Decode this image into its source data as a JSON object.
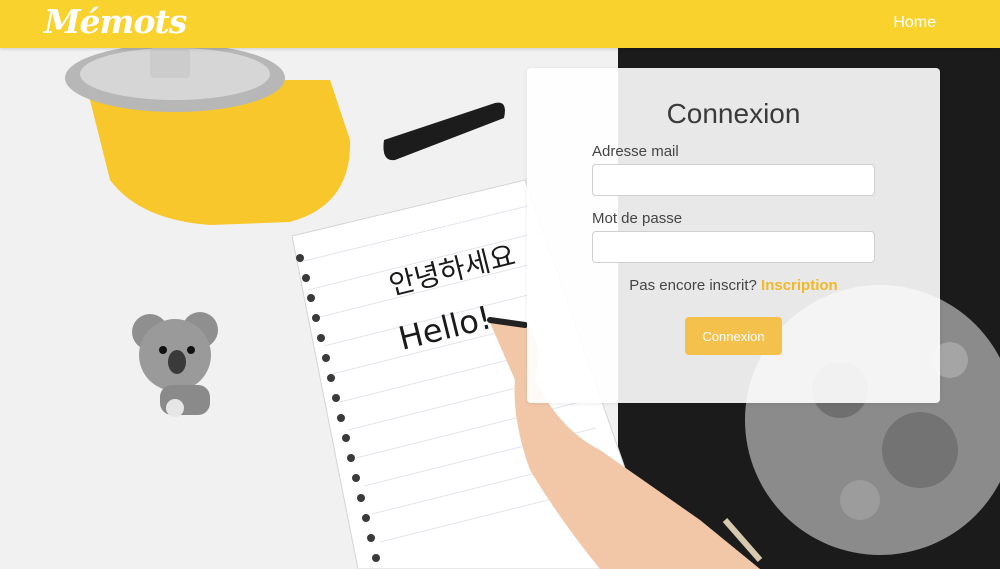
{
  "header": {
    "brand": "Mémots",
    "nav_home": "Home",
    "color": "#fad22e"
  },
  "login": {
    "title": "Connexion",
    "email_label": "Adresse mail",
    "email_value": "",
    "password_label": "Mot de passe",
    "password_value": "",
    "signup_prompt": "Pas encore inscrit?",
    "signup_link": "Inscription",
    "submit_label": "Connexion",
    "button_color": "#f4c14d",
    "link_color": "#f0b929"
  },
  "background": {
    "note_line1": "안녕하세요",
    "note_line2": "Hello!"
  }
}
